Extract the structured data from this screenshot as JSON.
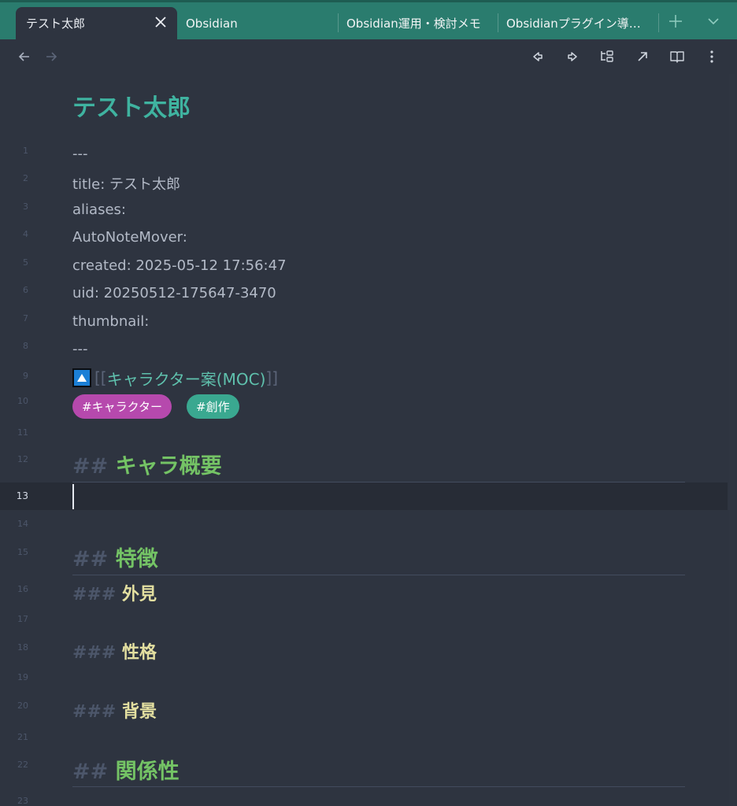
{
  "tabs": {
    "active": "テスト太郎",
    "others": [
      "Obsidian",
      "Obsidian運用・検討メモ",
      "Obsidianプラグイン導…"
    ]
  },
  "note": {
    "inline_title": "テスト太郎",
    "frontmatter": {
      "sep_open": "---",
      "title": "title: テスト太郎",
      "aliases": "aliases:",
      "autonotemover": "AutoNoteMover:",
      "created": "created: 2025-05-12 17:56:47",
      "uid": "uid: 20250512-175647-3470",
      "thumbnail": "thumbnail:",
      "sep_close": "---"
    },
    "link": {
      "open": "[[",
      "text": "キャラクター案(MOC)",
      "close": "]]"
    },
    "tags": [
      "#キャラクター",
      "#創作"
    ],
    "headings": {
      "h2_hash": "##",
      "h3_hash": "###",
      "overview": "キャラ概要",
      "features": "特徴",
      "appearance": "外見",
      "personality": "性格",
      "background": "背景",
      "relations": "関係性"
    },
    "line_numbers": [
      "1",
      "2",
      "3",
      "4",
      "5",
      "6",
      "7",
      "8",
      "9",
      "10",
      "11",
      "12",
      "13",
      "14",
      "15",
      "16",
      "17",
      "18",
      "19",
      "20",
      "21",
      "22",
      "23"
    ]
  },
  "colors": {
    "accent": "#2a7c6e",
    "title": "#3fb3a0",
    "h2": "#74c365",
    "h3": "#e3dfa0",
    "tag_character": "#b649ad",
    "tag_creation": "#3aa890"
  }
}
